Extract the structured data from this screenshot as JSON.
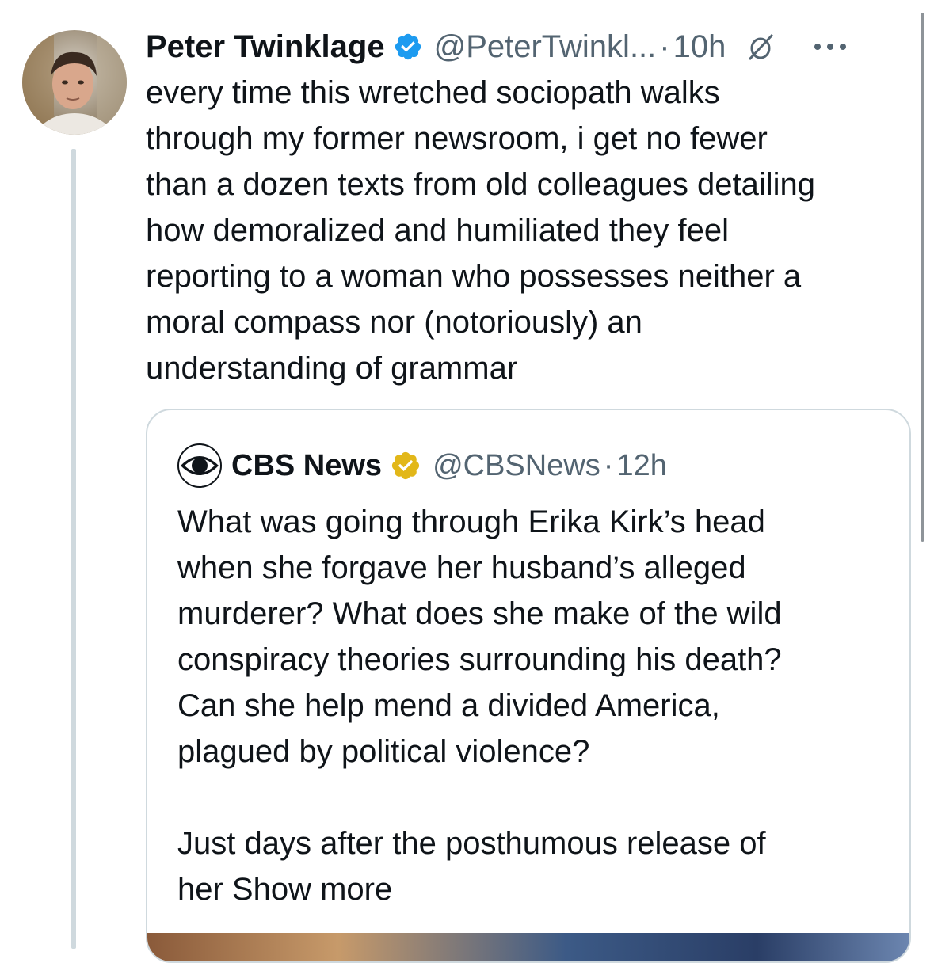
{
  "tweet": {
    "author_name": "Peter Twinklage",
    "author_handle": "@PeterTwinkl...",
    "separator": "·",
    "time": "10h",
    "text": "every time this wretched sociopath walks\nthrough my former newsroom, i get no fewer\nthan a dozen texts from old colleagues detailing\nhow demoralized and humiliated they feel\nreporting to a woman who possesses neither a\nmoral compass nor (notoriously) an\nunderstanding of grammar",
    "icons": {
      "verified": "verified-badge-icon",
      "muted": "muted-icon",
      "more": "more-options-icon"
    }
  },
  "quote": {
    "author_name": "CBS News",
    "author_handle": "@CBSNews",
    "separator": "·",
    "time": "12h",
    "text": "What was going through Erika Kirk’s head\nwhen she forgave her husband’s alleged\nmurderer? What does she make of the wild\nconspiracy theories surrounding his death?\nCan she help mend a divided America,\nplagued by political violence?\n\nJust days after the posthumous release of\nher Show more",
    "icons": {
      "logo": "cbs-eye-logo-icon",
      "verified": "gold-verified-badge-icon"
    }
  },
  "colors": {
    "text": "#0f1419",
    "secondary": "#536471",
    "verified_blue": "#1d9bf0",
    "verified_gold": "#e2b719",
    "border": "#cfd9de"
  }
}
